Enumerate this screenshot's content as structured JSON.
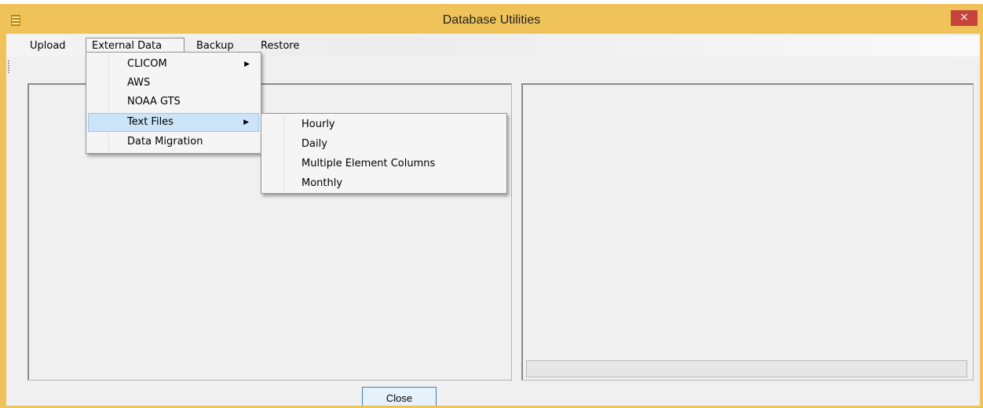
{
  "window": {
    "title": "Database Utilities",
    "close_glyph": "×",
    "app_icon": "database-icon",
    "title_color": "#f0c35a"
  },
  "menubar": {
    "items": [
      "Upload",
      "External Data",
      "Backup",
      "Restore"
    ]
  },
  "external_data_menu": {
    "items": [
      {
        "label": "CLICOM",
        "submenu_arrow": "▶"
      },
      {
        "label": "AWS"
      },
      {
        "label": "NOAA GTS"
      },
      {
        "label": "Text Files",
        "submenu_arrow": "▶"
      },
      {
        "label": "Data Migration"
      }
    ]
  },
  "text_files_submenu": {
    "items": [
      "Hourly",
      "Daily",
      "Multiple Element Columns",
      "Monthly"
    ]
  },
  "footer": {
    "close_label": "Close"
  }
}
